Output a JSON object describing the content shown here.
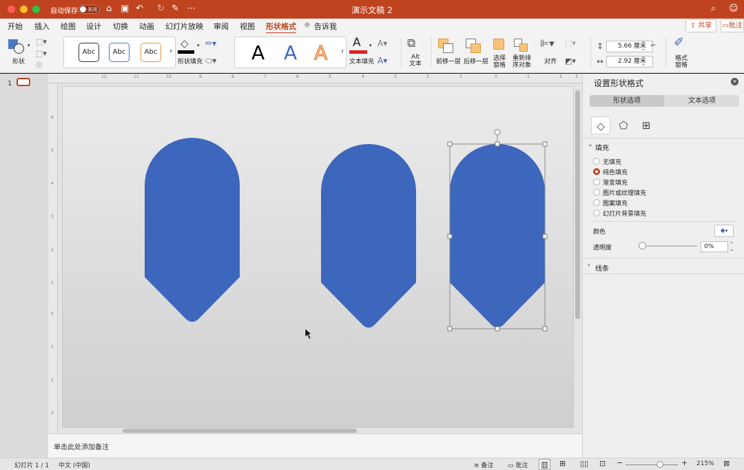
{
  "titlebar": {
    "autosave_label": "自动保存",
    "autosave_state": "关闭",
    "doc_title": "演示文稿 2"
  },
  "menu": {
    "items": [
      "开始",
      "插入",
      "绘图",
      "设计",
      "切换",
      "动画",
      "幻灯片放映",
      "审阅",
      "视图",
      "形状格式"
    ],
    "active": "形状格式",
    "tell_me": "告诉我",
    "share": "共享",
    "comments": "批注"
  },
  "ribbon": {
    "shapes_label": "形状",
    "style_samples": [
      "Abc",
      "Abc",
      "Abc"
    ],
    "shape_fill_label": "形状填充",
    "wordart_samples": [
      "A",
      "A",
      "A"
    ],
    "text_fill_label": "文本填充",
    "alt_text_label": [
      "Alt",
      "文本"
    ],
    "bring_forward": "前移一层",
    "send_backward": "后移一层",
    "selection_pane": [
      "选择",
      "窗格"
    ],
    "reorder": [
      "重新排",
      "序对象"
    ],
    "align": "对齐",
    "height_value": "5.66 厘米",
    "width_value": "2.92 厘米",
    "format_pane": [
      "格式",
      "窗格"
    ]
  },
  "slides_panel": {
    "slide_number": "1"
  },
  "ruler": {
    "h_ticks": [
      "12",
      "11",
      "10",
      "9",
      "8",
      "7",
      "6",
      "5",
      "4",
      "3",
      "2",
      "1",
      "0",
      "1",
      "2",
      "3"
    ],
    "v_ticks": [
      "6",
      "5",
      "4",
      "3",
      "2",
      "1",
      "0",
      "1",
      "2",
      "3"
    ]
  },
  "notes": {
    "placeholder": "单击此处添加备注"
  },
  "format_pane": {
    "title": "设置形状格式",
    "tabs": [
      "形状选项",
      "文本选项"
    ],
    "active_tab": "形状选项",
    "fill_section": "填充",
    "fill_options": [
      "无填充",
      "纯色填充",
      "渐变填充",
      "图片或纹理填充",
      "图案填充",
      "幻灯片背景填充"
    ],
    "selected_fill": "纯色填充",
    "color_label": "颜色",
    "transparency_label": "透明度",
    "transparency_value": "0%",
    "line_section": "线条"
  },
  "statusbar": {
    "slide_info": "幻灯片 1 / 1",
    "language": "中文 (中国)",
    "notes": "备注",
    "comments": "批注",
    "zoom": "215%"
  },
  "colors": {
    "shape_fill": "#3d67bd",
    "accent": "#c0431f"
  }
}
